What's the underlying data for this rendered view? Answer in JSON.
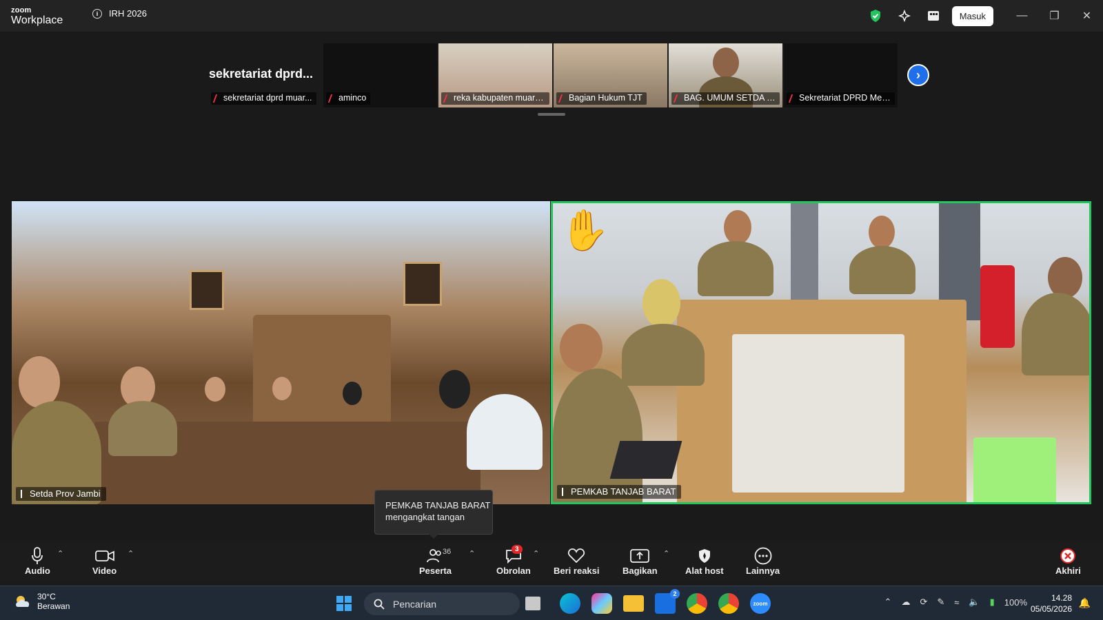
{
  "app": {
    "brand_top": "zoom",
    "brand_bottom": "Workplace",
    "meeting_title": "IRH 2026",
    "signin_label": "Masuk"
  },
  "strip": {
    "active_name": "sekretariat dprd...",
    "participants": [
      {
        "name": "sekretariat dprd muar..."
      },
      {
        "name": "aminco"
      },
      {
        "name": "reka kabupaten muaro..."
      },
      {
        "name": "Bagian Hukum TJT"
      },
      {
        "name": "BAG. UMUM SETDA K..."
      },
      {
        "name": "Sekretariat DPRD Mer..."
      }
    ]
  },
  "videos": {
    "left_label": "Setda Prov Jambi",
    "right_label": "PEMKAB TANJAB BARAT"
  },
  "tooltip": {
    "line1": "PEMKAB TANJAB BARAT",
    "line2": "mengangkat tangan"
  },
  "toolbar": {
    "audio": "Audio",
    "video": "Video",
    "participants": "Peserta",
    "participants_count": "36",
    "chat": "Obrolan",
    "chat_badge": "3",
    "reactions": "Beri reaksi",
    "share": "Bagikan",
    "host_tools": "Alat host",
    "more": "Lainnya",
    "end": "Akhiri"
  },
  "taskbar": {
    "temp": "30°C",
    "weather": "Berawan",
    "search_placeholder": "Pencarian",
    "battery": "100%",
    "time": "14.28",
    "date": "05/05/2026",
    "store_badge": "2"
  },
  "colors": {
    "active_speaker": "#22c55e",
    "accent": "#1f6feb",
    "end": "#e02828"
  }
}
